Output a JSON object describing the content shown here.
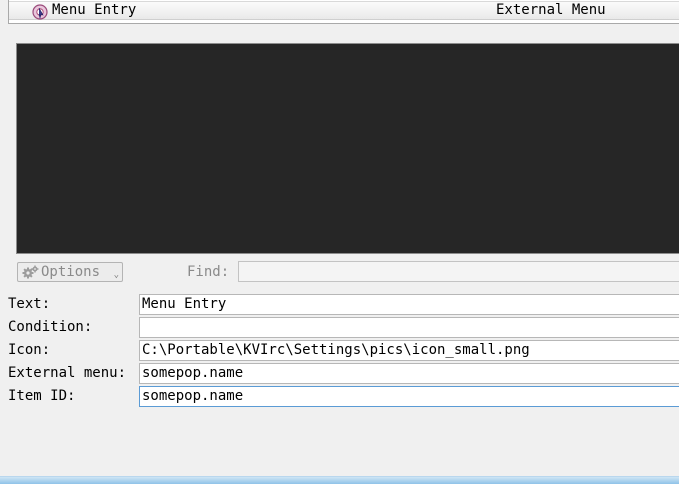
{
  "tree": {
    "selected_item": {
      "name": "Menu Entry",
      "type": "External Menu",
      "icon": "menu-entry-icon"
    }
  },
  "find": {
    "label": "Find:",
    "value": ""
  },
  "options": {
    "label": "Options",
    "icon": "gear-icon"
  },
  "form": {
    "fields": [
      {
        "label": "Text:",
        "value": "Menu Entry"
      },
      {
        "label": "Condition:",
        "value": ""
      },
      {
        "label": "Icon:",
        "value": "C:\\Portable\\KVIrc\\Settings\\pics\\icon_small.png"
      },
      {
        "label": "External menu:",
        "value": "somepop.name"
      },
      {
        "label": "Item ID:",
        "value": "somepop.name"
      }
    ]
  },
  "colors": {
    "editor_background": "#262626",
    "window_background": "#f0f0f0",
    "focus_border": "#5b9bd5"
  }
}
